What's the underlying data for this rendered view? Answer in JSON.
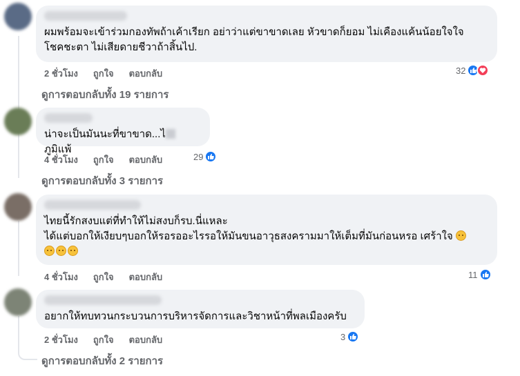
{
  "colors": {
    "bubble": "#f0f2f5",
    "meta_text": "#65676b",
    "like": "#1877f2",
    "love": "#f33e58"
  },
  "comments": [
    {
      "text": "ผมพร้อมจะเข้าร่วมกองทัพถ้าเค้าเรียก อย่าว่าแต่ขาขาดเลย หัวขาดก็ยอม ไม่เคืองแค้นน้อยใจใจ\nโชคชะตา ไม่เสียดายชีวาถ้าสิ้นไป.",
      "time": "2 ชั่วโมง",
      "like": "ถูกใจ",
      "reply": "ตอบกลับ",
      "reaction_count": "32",
      "reactions": [
        "like-icon",
        "love-icon"
      ],
      "view_replies": "ดูการตอบกลับทั้ง 19 รายการ"
    },
    {
      "text_before": "น่าจะเป็นมันนะที่ขาขาด...ไ",
      "text_after": "ภูมิแพ้",
      "time": "4 ชั่วโมง",
      "like": "ถูกใจ",
      "reply": "ตอบกลับ",
      "reaction_count": "29",
      "reactions": [
        "like-icon"
      ],
      "view_replies": "ดูการตอบกลับทั้ง 3 รายการ"
    },
    {
      "text_line1": "ไทยนี้รักสงบแต่ที่ทำให้ไม่สงบก็รบ.นี่แหละ",
      "text_line2": "ได้แต่บอกให้เงียบๆบอกให้รอรออะไรรอให้มันขนอาวุธสงครามมาให้เต็มที่มันก่อนหรอ เศร้าใจ",
      "time": "4 ชั่วโมง",
      "like": "ถูกใจ",
      "reply": "ตอบกลับ",
      "reaction_count": "11",
      "reactions": [
        "like-icon"
      ],
      "emojis": [
        "sad-emoji-icon",
        "eyeroll-emoji-icon",
        "disappointed-emoji-icon",
        "relieved-emoji-icon"
      ]
    },
    {
      "text": "อยากให้ทบทวนกระบวนการบริหารจัดการและวิชาหน้าที่พลเมืองครับ",
      "time": "2 ชั่วโมง",
      "like": "ถูกใจ",
      "reply": "ตอบกลับ",
      "reaction_count": "3",
      "reactions": [
        "like-icon"
      ],
      "view_replies": "ดูการตอบกลับทั้ง 2 รายการ"
    }
  ]
}
